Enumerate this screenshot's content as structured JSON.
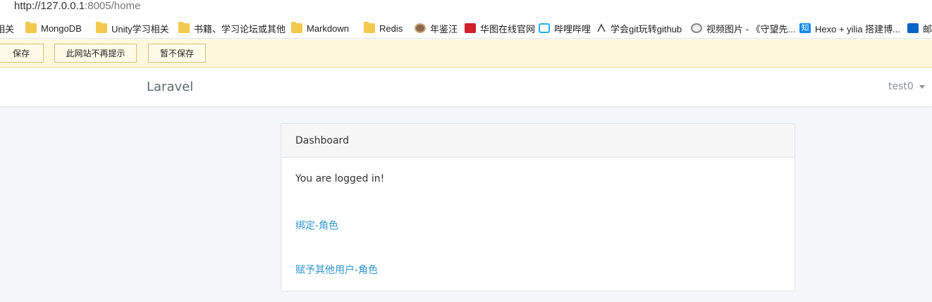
{
  "browser": {
    "url_host": "http://127.0.0.1",
    "url_rest": ":8005/home"
  },
  "bookmarks": [
    {
      "label": "相关",
      "icon": "folder-icon"
    },
    {
      "label": "MongoDB",
      "icon": "folder-icon"
    },
    {
      "label": "Unity学习相关",
      "icon": "folder-icon"
    },
    {
      "label": "书籍、学习论坛或其他",
      "icon": "folder-icon"
    },
    {
      "label": "Markdown",
      "icon": "folder-icon"
    },
    {
      "label": "Redis",
      "icon": "folder-icon"
    },
    {
      "label": "年鉴汪",
      "icon": "avatar-icon"
    },
    {
      "label": "华图在线官网",
      "icon": "huatu-logo-icon"
    },
    {
      "label": "哔哩哔哩",
      "icon": "bilibili-icon"
    },
    {
      "label": "学会git玩转github",
      "icon": "zhihu-style-icon"
    },
    {
      "label": "视频图片 - 《守望先...",
      "icon": "overwatch-icon"
    },
    {
      "label": "Hexo + yilia 搭建博...",
      "icon": "zhihu-icon"
    },
    {
      "label": "邮",
      "icon": "outlook-icon"
    }
  ],
  "save_prompt": {
    "save": "保存",
    "never": "此网站不再提示",
    "not_now": "暂不保存"
  },
  "navbar": {
    "brand": "Laravel",
    "user": "test0"
  },
  "card": {
    "header": "Dashboard",
    "message": "You are logged in!",
    "link1": "绑定-角色",
    "link2": "赋予其他用户-角色"
  },
  "colors": {
    "link": "#3097d1",
    "page_bg": "#f5f8fa",
    "savebar_bg": "#fff8dc"
  }
}
